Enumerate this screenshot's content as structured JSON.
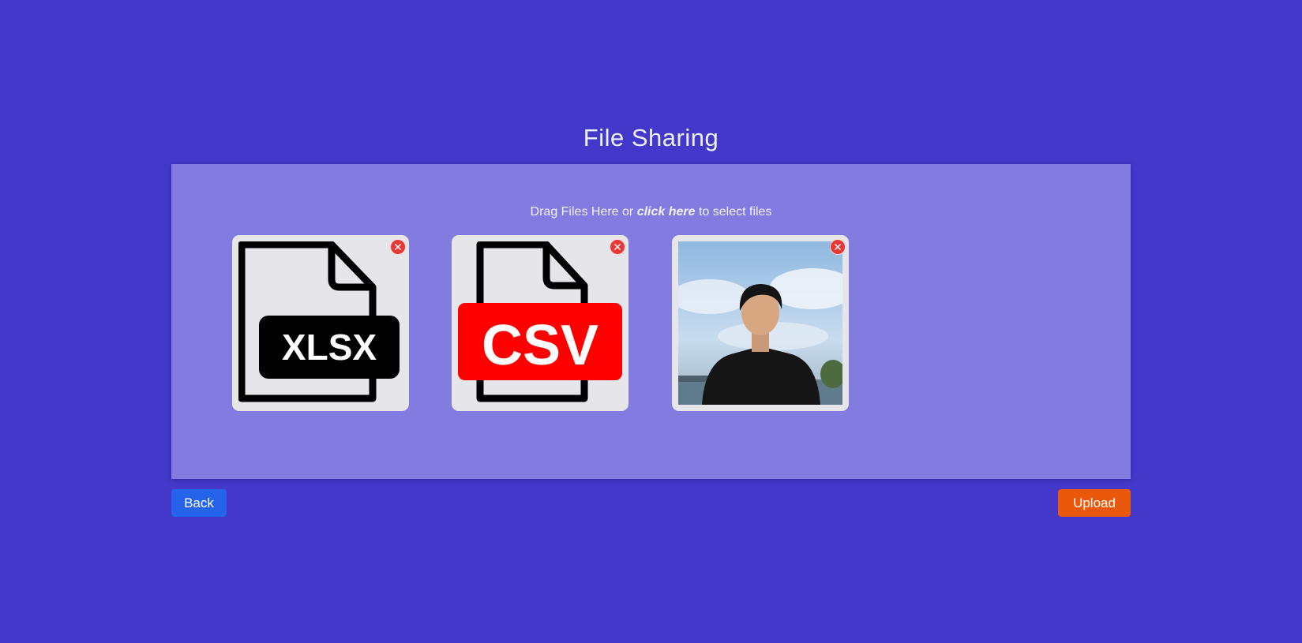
{
  "page": {
    "title": "File Sharing"
  },
  "dropzone": {
    "hint_prefix": "Drag Files Here or ",
    "hint_link": "click here",
    "hint_suffix": " to select files"
  },
  "files": [
    {
      "type_label": "XLSX",
      "icon": "xlsx-file-icon",
      "badge_color": "#000000"
    },
    {
      "type_label": "CSV",
      "icon": "csv-file-icon",
      "badge_color": "#ff0000"
    },
    {
      "icon": "photo-thumbnail"
    }
  ],
  "buttons": {
    "back_label": "Back",
    "upload_label": "Upload"
  },
  "colors": {
    "background": "#4338ca",
    "dropzone": "#827ce0",
    "back_button": "#2563eb",
    "upload_button": "#ea580c",
    "remove_button": "#e53935"
  }
}
